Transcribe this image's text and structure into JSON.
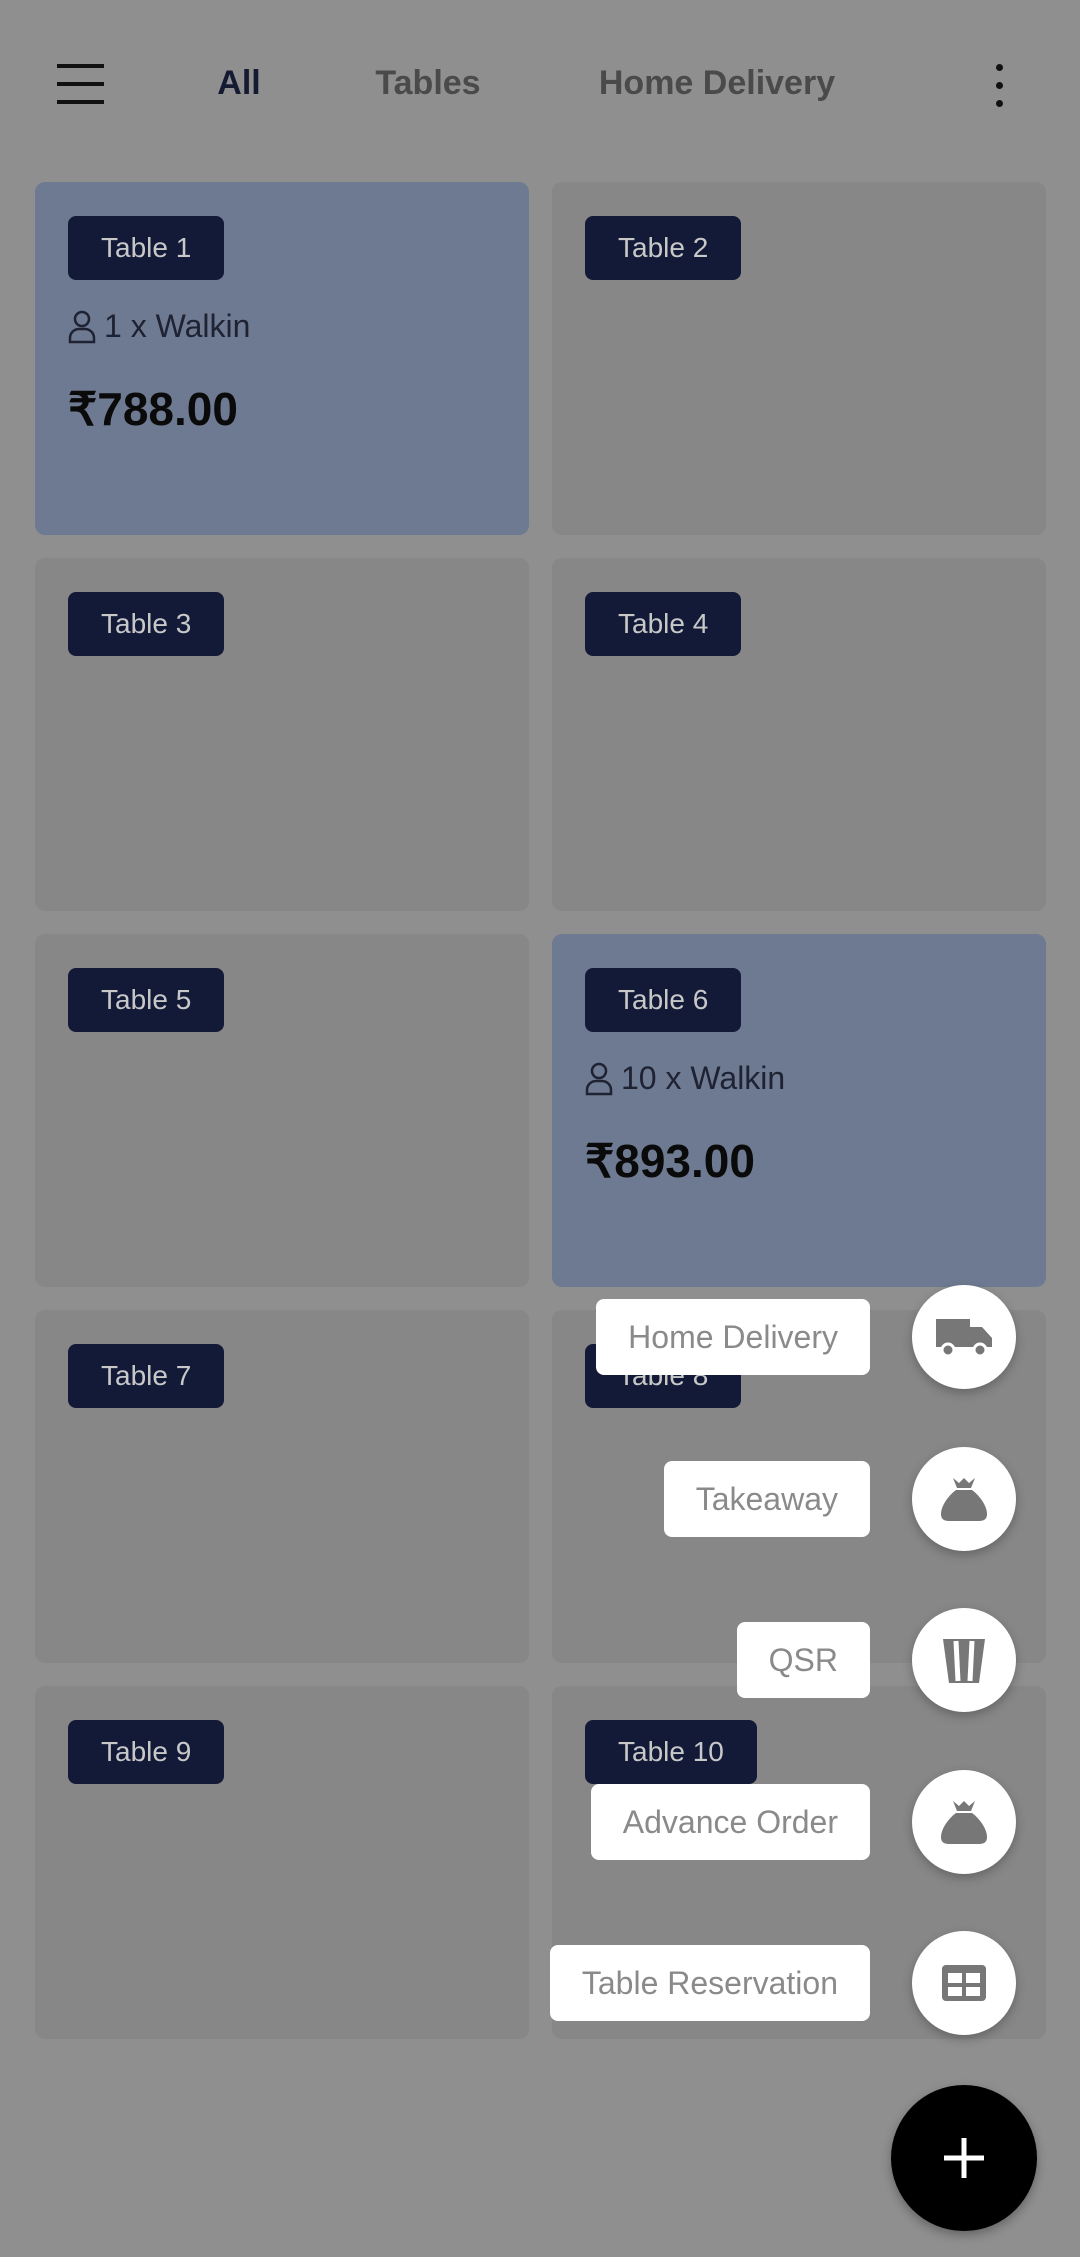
{
  "header": {
    "tabs": [
      {
        "label": "All",
        "active": true
      },
      {
        "label": "Tables",
        "active": false
      },
      {
        "label": "Home Delivery",
        "active": false
      }
    ]
  },
  "tables": [
    {
      "name": "Table 1",
      "occupied": true,
      "guests": "1 x Walkin",
      "amount": "₹788.00"
    },
    {
      "name": "Table 2",
      "occupied": false
    },
    {
      "name": "Table 3",
      "occupied": false
    },
    {
      "name": "Table 4",
      "occupied": false
    },
    {
      "name": "Table 5",
      "occupied": false
    },
    {
      "name": "Table 6",
      "occupied": true,
      "guests": "10 x Walkin",
      "amount": "₹893.00"
    },
    {
      "name": "Table 7",
      "occupied": false
    },
    {
      "name": "Table 8",
      "occupied": false
    },
    {
      "name": "Table 9",
      "occupied": false
    },
    {
      "name": "Table 10",
      "occupied": false
    }
  ],
  "fab_menu": [
    {
      "label": "Home Delivery",
      "icon": "truck-icon"
    },
    {
      "label": "Takeaway",
      "icon": "bag-icon"
    },
    {
      "label": "QSR",
      "icon": "popcorn-icon"
    },
    {
      "label": "Advance Order",
      "icon": "bag-icon"
    },
    {
      "label": "Table Reservation",
      "icon": "table-icon"
    }
  ],
  "colors": {
    "occupied": "#6d7a91",
    "badge": "#121a38",
    "fab": "#000000"
  }
}
